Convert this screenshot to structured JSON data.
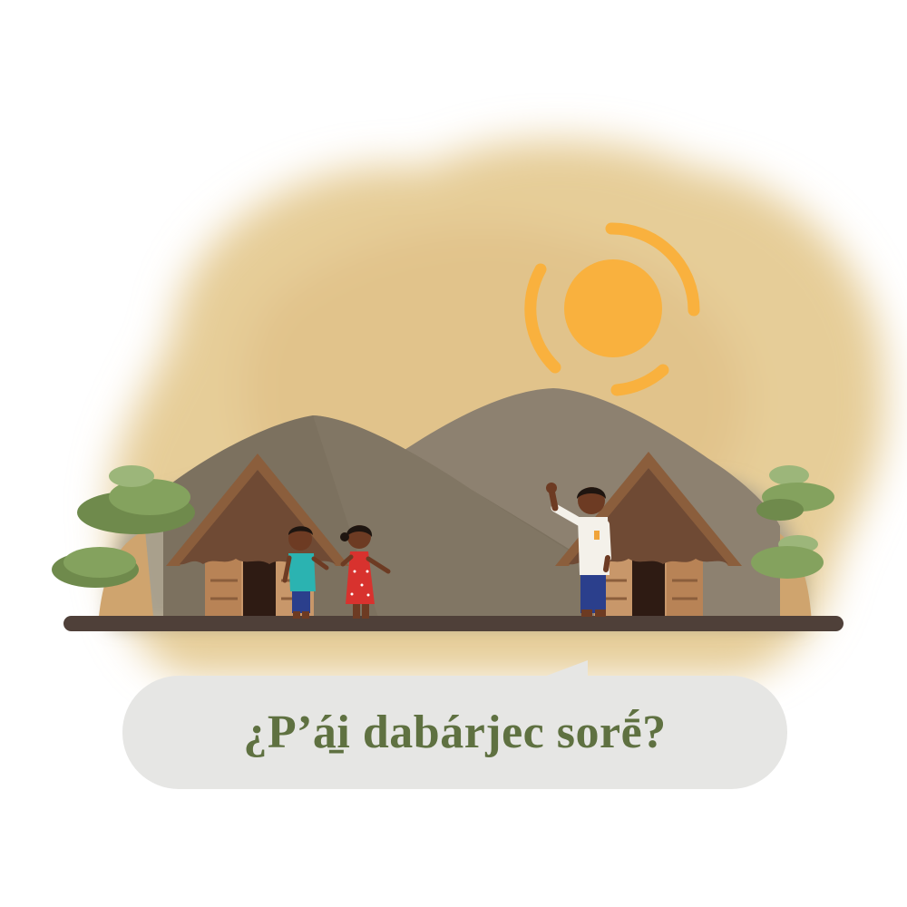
{
  "caption": {
    "text": "¿P’á̱i dabárjec sorḗ?"
  },
  "colors": {
    "background": "#ffffff",
    "wash": "#e6cd98",
    "sun": "#f9b13e",
    "mountain": "#8d8170",
    "hut_roof": "#6f4a34",
    "hut_wall": "#c8976a",
    "tree": "#84a25e",
    "ground": "#4f4039",
    "bubble": "#e6e6e4",
    "caption_text": "#5f7141"
  },
  "icons": [
    "sun-icon",
    "mountain-icon",
    "hut-icon",
    "tree-icon",
    "child-icon",
    "man-icon",
    "speech-bubble-icon"
  ]
}
